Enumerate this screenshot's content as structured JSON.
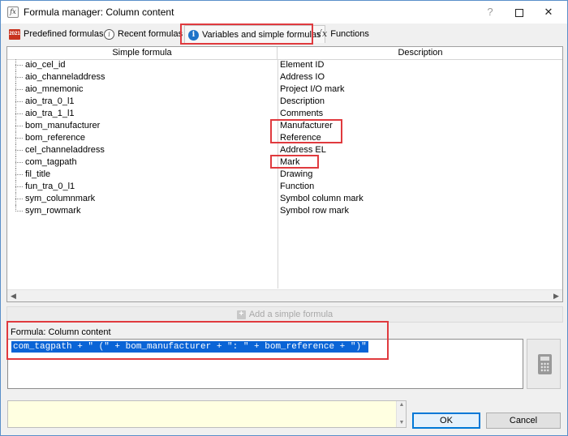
{
  "window": {
    "title": "Formula manager: Column content",
    "app_icon": "formula-fx-icon",
    "help_glyph": "?",
    "close_glyph": "✕"
  },
  "tabs": [
    {
      "label": "Predefined formulas",
      "icon": "2021-app-icon",
      "icon_text": "2021"
    },
    {
      "label": "Recent formulas",
      "icon": "info-outline-icon",
      "icon_text": "i"
    },
    {
      "label": "Variables and simple formulas",
      "icon": "info-filled-icon",
      "icon_text": "i",
      "active": true
    },
    {
      "label": "Functions",
      "icon": "sqrt-x-icon",
      "icon_text": "√x"
    }
  ],
  "table": {
    "columns": [
      "Simple formula",
      "Description"
    ],
    "rows": [
      {
        "formula": "aio_cel_id",
        "description": "Element ID"
      },
      {
        "formula": "aio_channeladdress",
        "description": "Address IO"
      },
      {
        "formula": "aio_mnemonic",
        "description": "Project I/O mark"
      },
      {
        "formula": "aio_tra_0_l1",
        "description": "Description"
      },
      {
        "formula": "aio_tra_1_l1",
        "description": "Comments"
      },
      {
        "formula": "bom_manufacturer",
        "description": "Manufacturer"
      },
      {
        "formula": "bom_reference",
        "description": "Reference"
      },
      {
        "formula": "cel_channeladdress",
        "description": "Address EL"
      },
      {
        "formula": "com_tagpath",
        "description": "Mark"
      },
      {
        "formula": "fil_title",
        "description": "Drawing"
      },
      {
        "formula": "fun_tra_0_l1",
        "description": "Function"
      },
      {
        "formula": "sym_columnmark",
        "description": "Symbol column mark"
      },
      {
        "formula": "sym_rowmark",
        "description": "Symbol row mark"
      }
    ]
  },
  "scroll": {
    "left_arrow": "◀",
    "right_arrow": "▶",
    "up_arrow": "▲",
    "down_arrow": "▼"
  },
  "add_button": {
    "label": "Add a simple formula",
    "plus": "+"
  },
  "formula_editor": {
    "label": "Formula: Column content",
    "value": "com_tagpath + \" (\" + bom_manufacturer + \": \" + bom_reference + \")\"",
    "calculator_icon": "calculator-icon"
  },
  "buttons": {
    "ok": "OK",
    "cancel": "Cancel"
  },
  "colors": {
    "highlight": "#e03a3e",
    "selection": "#0a64d6",
    "message_bg": "#ffffe1"
  }
}
